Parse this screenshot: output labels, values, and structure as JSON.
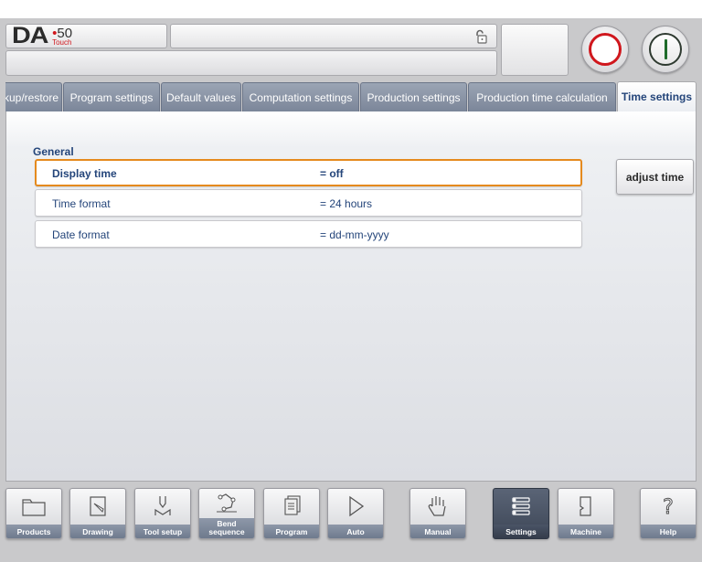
{
  "header": {
    "logo_main": "DA",
    "logo_number": "50",
    "logo_sub": "Touch",
    "title": "",
    "status": ""
  },
  "tabs": [
    {
      "label": "kup/restore"
    },
    {
      "label": "Program settings"
    },
    {
      "label": "Default values"
    },
    {
      "label": "Computation settings"
    },
    {
      "label": "Production settings"
    },
    {
      "label": "Production time calculation"
    },
    {
      "label": "Time settings",
      "active": true
    }
  ],
  "section": {
    "title": "General"
  },
  "rows": [
    {
      "label": "Display time",
      "value": "=  off"
    },
    {
      "label": "Time format",
      "value": "=  24 hours"
    },
    {
      "label": "Date format",
      "value": "=  dd-mm-yyyy"
    }
  ],
  "actions": {
    "adjust_time": "adjust time"
  },
  "nav": [
    {
      "label": "Products",
      "icon": "folder-icon"
    },
    {
      "label": "Drawing",
      "icon": "drawing-icon"
    },
    {
      "label": "Tool setup",
      "icon": "tool-icon"
    },
    {
      "label": "Bend",
      "label2": "sequence",
      "icon": "bend-sequence-icon"
    },
    {
      "label": "Program",
      "icon": "program-icon"
    },
    {
      "label": "Auto",
      "icon": "play-icon"
    },
    {
      "label": "Manual",
      "icon": "hand-icon"
    },
    {
      "label": "Settings",
      "icon": "settings-icon"
    },
    {
      "label": "Machine",
      "icon": "machine-icon"
    },
    {
      "label": "Help",
      "icon": "help-icon"
    }
  ],
  "colors": {
    "accent_selected": "#e58a1e",
    "text_blue": "#24457a",
    "stop_red": "#d0171d",
    "start_green": "#1e6b2a"
  }
}
